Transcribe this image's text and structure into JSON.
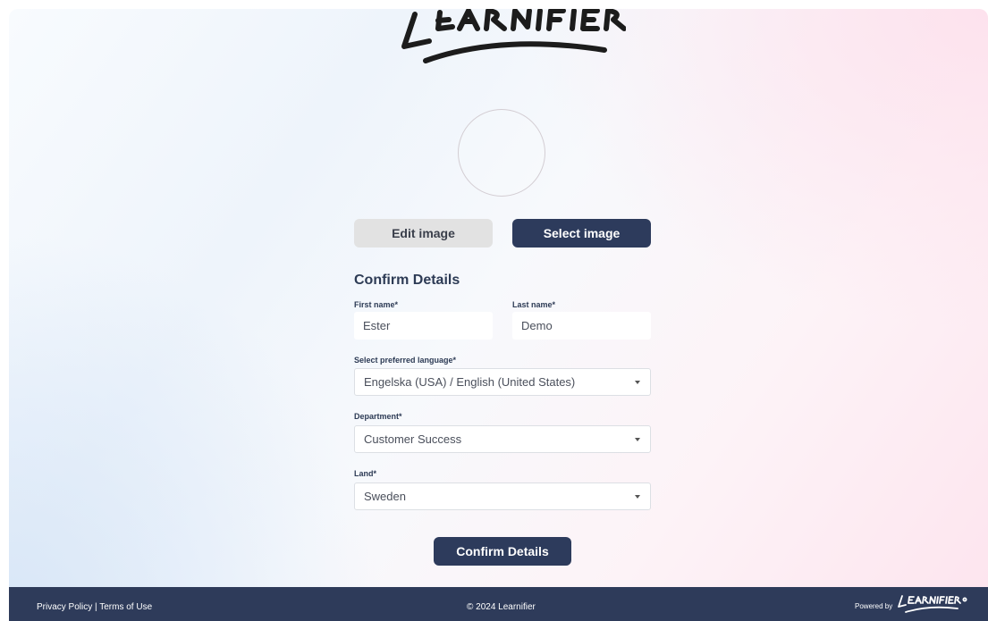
{
  "profile": {
    "edit_image_label": "Edit image",
    "select_image_label": "Select image"
  },
  "form": {
    "title": "Confirm Details",
    "first_name_label": "First name*",
    "first_name_value": "Ester",
    "last_name_label": "Last name*",
    "last_name_value": "Demo",
    "language_label": "Select preferred language*",
    "language_value": "Engelska (USA) / English (United States)",
    "department_label": "Department*",
    "department_value": "Customer Success",
    "land_label": "Land*",
    "land_value": "Sweden",
    "confirm_button": "Confirm Details"
  },
  "footer": {
    "privacy": "Privacy Policy",
    "separator": " | ",
    "terms": "Terms of Use",
    "copyright": "© 2024 Learnifier",
    "powered_by": "Powered by"
  },
  "colors": {
    "primary": "#2d3b5c",
    "secondary_button": "#e2e2e2",
    "footer_bg": "#2e3b5a"
  }
}
